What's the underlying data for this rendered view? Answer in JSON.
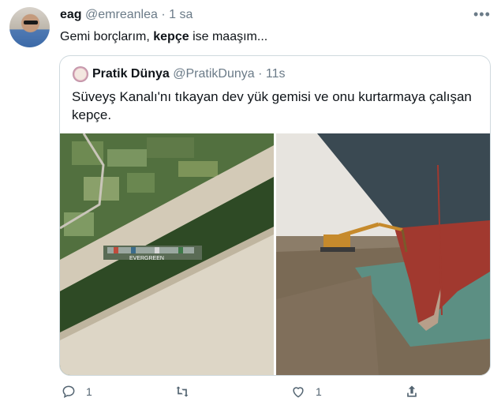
{
  "tweet": {
    "name": "eag",
    "handle": "@emreanlea",
    "separator": "·",
    "time": "1 sa",
    "text_before": "Gemi borçlarım, ",
    "text_bold": "kepçe",
    "text_after": " ise maaşım...",
    "more_label": "•••"
  },
  "quote": {
    "name": "Pratik Dünya",
    "handle": "@PratikDunya",
    "separator": "·",
    "time": "11s",
    "text": "Süveyş Kanalı'nı tıkayan dev yük gemisi ve onu kurtarmaya çalışan kepçe.",
    "ship_name": "EVERGREEN"
  },
  "actions": {
    "reply_count": "1",
    "retweet_count": "",
    "like_count": "1"
  },
  "icons": [
    "reply-icon",
    "retweet-icon",
    "like-icon",
    "share-icon",
    "more-icon"
  ],
  "colors": {
    "muted": "#536471",
    "border": "#cfd9de",
    "text": "#0f1419"
  }
}
